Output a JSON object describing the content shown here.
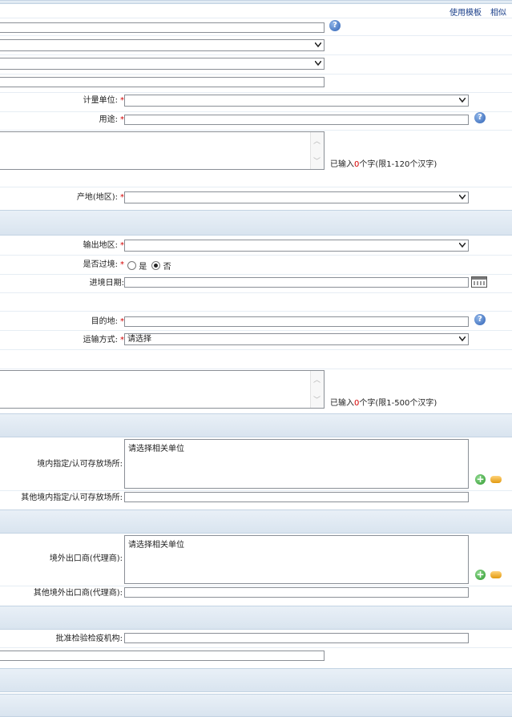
{
  "top_links": {
    "use_template": "使用模板",
    "similar": "相似"
  },
  "fields": {
    "unit": {
      "label": "计量单位:",
      "req": "*",
      "value": ""
    },
    "usage": {
      "label": "用途:",
      "req": "*",
      "value": ""
    },
    "desc_hint": {
      "prefix": "已输入",
      "count": "0",
      "suffix": "个字(限1-120个汉字)"
    },
    "origin": {
      "label": "产地(地区):",
      "req": "*",
      "value": ""
    },
    "export_region": {
      "label": "输出地区:",
      "req": "*",
      "value": ""
    },
    "transit": {
      "label": "是否过境:",
      "req": "*",
      "opt_yes": "是",
      "opt_no": "否"
    },
    "entry_date": {
      "label": "进境日期:",
      "value": ""
    },
    "destination": {
      "label": "目的地:",
      "req": "*",
      "value": ""
    },
    "transport": {
      "label": "运输方式:",
      "req": "*",
      "value": "请选择"
    },
    "remark_hint": {
      "prefix": "已输入",
      "count": "0",
      "suffix": "个字(限1-500个汉字)"
    },
    "storage": {
      "label": "境内指定/认可存放场所:",
      "placeholder": "请选择相关单位"
    },
    "other_storage": {
      "label": "其他境内指定/认可存放场所:",
      "value": ""
    },
    "exporter": {
      "label": "境外出口商(代理商):",
      "placeholder": "请选择相关单位"
    },
    "other_exporter": {
      "label": "其他境外出口商(代理商):",
      "value": ""
    },
    "quarantine_org": {
      "label": "批准检验检疫机构:",
      "value": ""
    }
  }
}
